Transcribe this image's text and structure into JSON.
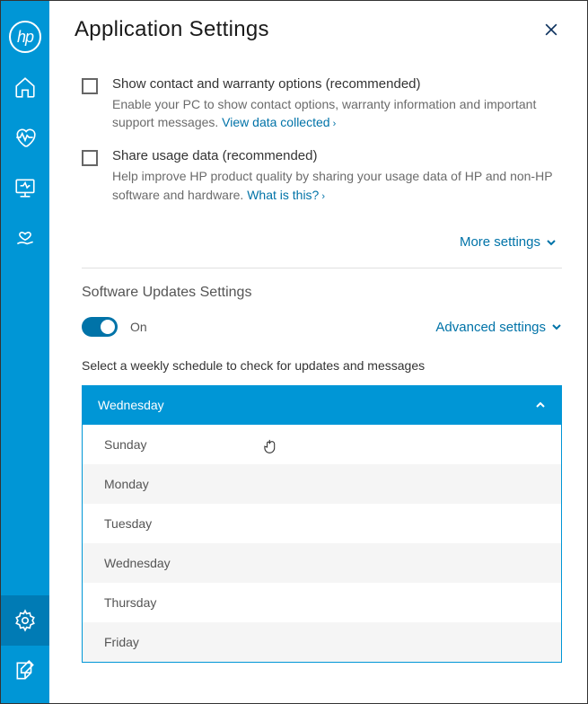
{
  "header": {
    "title": "Application Settings"
  },
  "privacy": {
    "items": [
      {
        "title": "Show contact and warranty options (recommended)",
        "desc_pre": "Enable your PC to show contact options, warranty information and important support messages. ",
        "link": "View data collected"
      },
      {
        "title": "Share usage data (recommended)",
        "desc_pre": "Help improve HP product quality by sharing your usage data of HP and non-HP software and hardware. ",
        "link": "What is this?"
      }
    ],
    "more_label": "More settings"
  },
  "updates": {
    "section_title": "Software Updates Settings",
    "toggle_label": "On",
    "advanced_label": "Advanced settings",
    "schedule_label": "Select a weekly schedule to check for updates and messages",
    "selected": "Wednesday",
    "options": [
      "Sunday",
      "Monday",
      "Tuesday",
      "Wednesday",
      "Thursday",
      "Friday"
    ]
  }
}
